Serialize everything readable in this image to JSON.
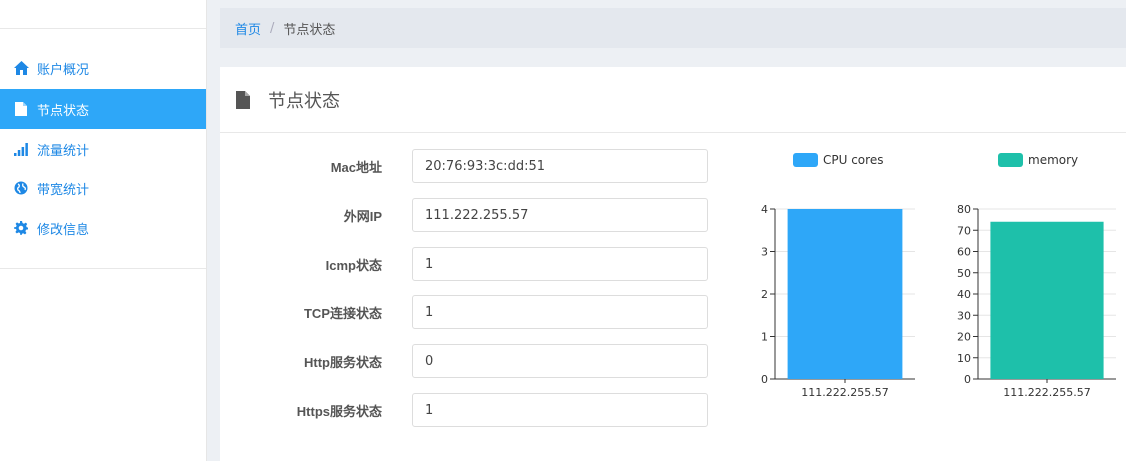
{
  "sidebar": {
    "items": [
      {
        "label": "账户概况",
        "icon": "home-icon",
        "active": false
      },
      {
        "label": "节点状态",
        "icon": "file-icon",
        "active": true
      },
      {
        "label": "流量统计",
        "icon": "signal-icon",
        "active": false
      },
      {
        "label": "带宽统计",
        "icon": "globe-icon",
        "active": false
      },
      {
        "label": "修改信息",
        "icon": "gear-icon",
        "active": false
      }
    ]
  },
  "breadcrumb": {
    "home": "首页",
    "separator": "/",
    "current": "节点状态"
  },
  "panel": {
    "title": "节点状态",
    "fields": [
      {
        "label": "Mac地址",
        "value": "20:76:93:3c:dd:51"
      },
      {
        "label": "外网IP",
        "value": "111.222.255.57"
      },
      {
        "label": "Icmp状态",
        "value": "1"
      },
      {
        "label": "TCP连接状态",
        "value": "1"
      },
      {
        "label": "Http服务状态",
        "value": "0"
      },
      {
        "label": "Https服务状态",
        "value": "1"
      }
    ]
  },
  "colors": {
    "accent": "#2ea7f8",
    "cpu": "#2ea7f8",
    "memory": "#1ec0aa"
  },
  "chart_data": [
    {
      "type": "bar",
      "categories": [
        "111.222.255.57"
      ],
      "series": [
        {
          "name": "CPU cores",
          "values": [
            4
          ]
        }
      ],
      "ylim": [
        0,
        4
      ],
      "yticks": [
        0,
        1,
        2,
        3,
        4
      ],
      "legend": "top",
      "grid": true
    },
    {
      "type": "bar",
      "categories": [
        "111.222.255.57"
      ],
      "series": [
        {
          "name": "memory",
          "values": [
            74
          ]
        }
      ],
      "ylim": [
        0,
        80
      ],
      "yticks": [
        0,
        10,
        20,
        30,
        40,
        50,
        60,
        70,
        80
      ],
      "legend": "top",
      "grid": true
    }
  ]
}
